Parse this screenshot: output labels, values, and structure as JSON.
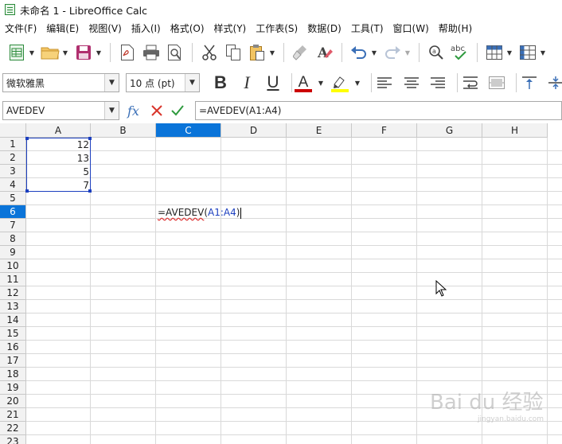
{
  "window": {
    "title": "未命名 1 - LibreOffice Calc"
  },
  "menu": {
    "items": [
      "文件(F)",
      "编辑(E)",
      "视图(V)",
      "插入(I)",
      "格式(O)",
      "样式(Y)",
      "工作表(S)",
      "数据(D)",
      "工具(T)",
      "窗口(W)",
      "帮助(H)"
    ]
  },
  "toolbar": {
    "icons": [
      "new-spreadsheet-icon",
      "open-folder-icon",
      "save-icon",
      "export-pdf-icon",
      "print-icon",
      "print-preview-icon",
      "cut-icon",
      "copy-icon",
      "paste-icon",
      "clone-formatting-icon",
      "clear-formatting-icon",
      "undo-icon",
      "redo-icon",
      "find-replace-icon",
      "spelling-icon",
      "row-icon",
      "column-icon"
    ]
  },
  "format_toolbar": {
    "font_name": "微软雅黑",
    "font_size": "10 点 (pt)",
    "bold": "B",
    "italic": "I",
    "underline": "U",
    "font_color_letter": "A",
    "font_color": "#cc0000",
    "highlight_color": "#ffff00"
  },
  "formula_bar": {
    "name_box": "AVEDEV",
    "fx_label": "fx",
    "formula": "=AVEDEV(A1:A4)"
  },
  "sheet": {
    "columns": [
      "A",
      "B",
      "C",
      "D",
      "E",
      "F",
      "G",
      "H"
    ],
    "active_column": "C",
    "rows": [
      "1",
      "2",
      "3",
      "4",
      "5",
      "6",
      "7",
      "8",
      "9",
      "10",
      "11",
      "12",
      "13",
      "14",
      "15",
      "16",
      "17",
      "18",
      "19",
      "20",
      "21",
      "22",
      "23"
    ],
    "active_row": "6",
    "cells": {
      "A1": "12",
      "A2": "13",
      "A3": "5",
      "A4": "7"
    },
    "editing_cell": {
      "prefix": "=AVEDEV",
      "paren_open": "(",
      "ref": "A1:A4",
      "paren_close": ")"
    }
  },
  "watermark": {
    "text": "Bai du 经验",
    "sub": "jingyan.baidu.com"
  },
  "colors": {
    "accent": "#0a74d9",
    "ref_blue": "#1c3fbf",
    "cancel_red": "#d9342b",
    "accept_green": "#2e9a3e"
  }
}
